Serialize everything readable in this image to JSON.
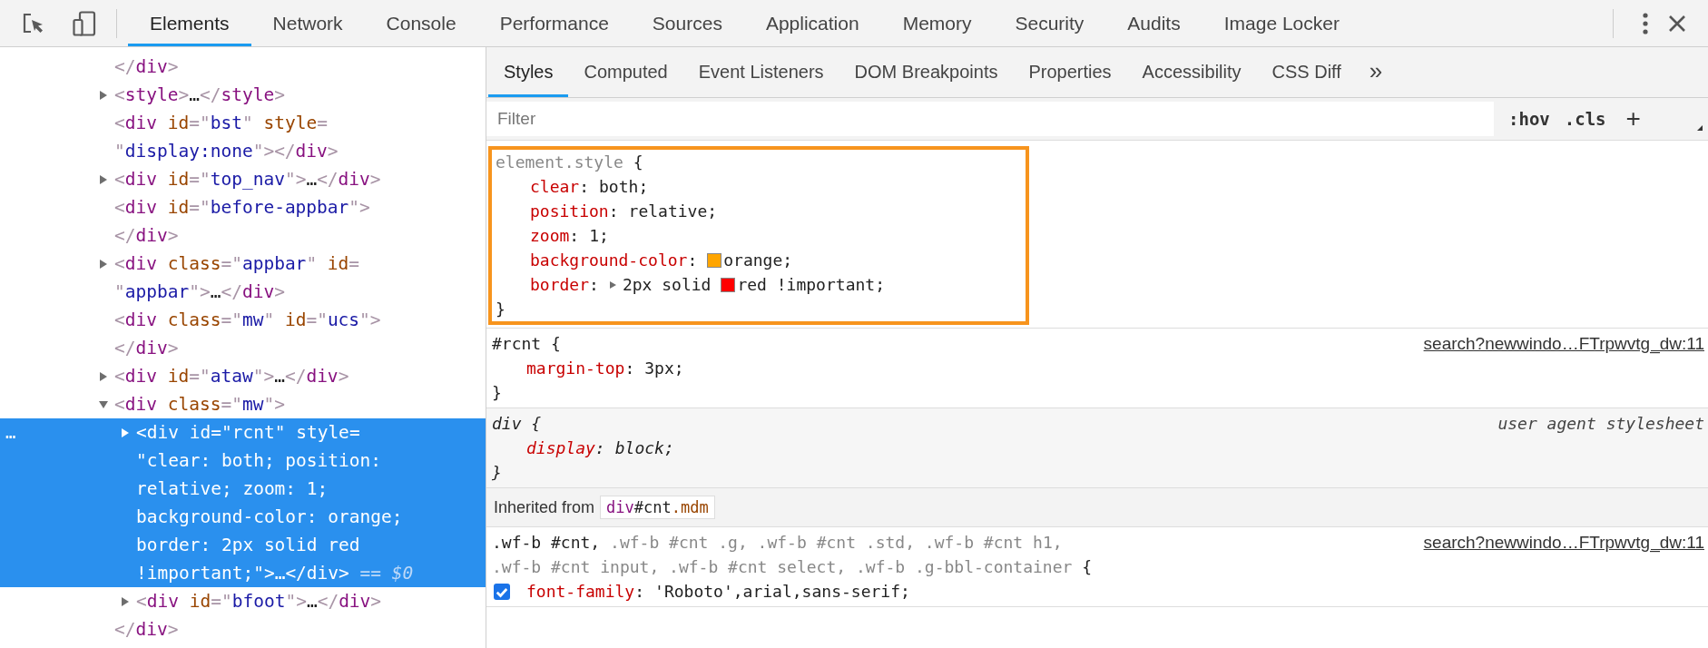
{
  "top_tabs": [
    {
      "label": "Elements",
      "selected": true
    },
    {
      "label": "Network",
      "selected": false
    },
    {
      "label": "Console",
      "selected": false
    },
    {
      "label": "Performance",
      "selected": false
    },
    {
      "label": "Sources",
      "selected": false
    },
    {
      "label": "Application",
      "selected": false
    },
    {
      "label": "Memory",
      "selected": false
    },
    {
      "label": "Security",
      "selected": false
    },
    {
      "label": "Audits",
      "selected": false
    },
    {
      "label": "Image Locker",
      "selected": false
    }
  ],
  "dom": [
    {
      "expandable": false,
      "expanded": false,
      "selected": false,
      "lines": [
        [
          {
            "kind": "punct",
            "text": "</"
          },
          {
            "kind": "tag",
            "text": "div"
          },
          {
            "kind": "punct",
            "text": ">"
          }
        ]
      ]
    },
    {
      "expandable": true,
      "expanded": false,
      "selected": false,
      "lines": [
        [
          {
            "kind": "punct",
            "text": "<"
          },
          {
            "kind": "tag",
            "text": "style"
          },
          {
            "kind": "punct",
            "text": ">"
          },
          {
            "kind": "text",
            "text": "…"
          },
          {
            "kind": "punct",
            "text": "</"
          },
          {
            "kind": "tag",
            "text": "style"
          },
          {
            "kind": "punct",
            "text": ">"
          }
        ]
      ]
    },
    {
      "expandable": false,
      "expanded": false,
      "selected": false,
      "lines": [
        [
          {
            "kind": "punct",
            "text": "<"
          },
          {
            "kind": "tag",
            "text": "div"
          },
          {
            "kind": "attr",
            "text": " id"
          },
          {
            "kind": "punct",
            "text": "=\""
          },
          {
            "kind": "value",
            "text": "bst"
          },
          {
            "kind": "punct",
            "text": "\""
          },
          {
            "kind": "attr",
            "text": " style"
          },
          {
            "kind": "punct",
            "text": "="
          }
        ],
        [
          {
            "kind": "punct",
            "text": "\""
          },
          {
            "kind": "value",
            "text": "display:none"
          },
          {
            "kind": "punct",
            "text": "\">"
          },
          {
            "kind": "punct",
            "text": "</"
          },
          {
            "kind": "tag",
            "text": "div"
          },
          {
            "kind": "punct",
            "text": ">"
          }
        ]
      ]
    },
    {
      "expandable": true,
      "expanded": false,
      "selected": false,
      "lines": [
        [
          {
            "kind": "punct",
            "text": "<"
          },
          {
            "kind": "tag",
            "text": "div"
          },
          {
            "kind": "attr",
            "text": " id"
          },
          {
            "kind": "punct",
            "text": "=\""
          },
          {
            "kind": "value",
            "text": "top_nav"
          },
          {
            "kind": "punct",
            "text": "\">"
          },
          {
            "kind": "text",
            "text": "…"
          },
          {
            "kind": "punct",
            "text": "</"
          },
          {
            "kind": "tag",
            "text": "div"
          },
          {
            "kind": "punct",
            "text": ">"
          }
        ]
      ]
    },
    {
      "expandable": false,
      "expanded": false,
      "selected": false,
      "lines": [
        [
          {
            "kind": "punct",
            "text": "<"
          },
          {
            "kind": "tag",
            "text": "div"
          },
          {
            "kind": "attr",
            "text": " id"
          },
          {
            "kind": "punct",
            "text": "=\""
          },
          {
            "kind": "value",
            "text": "before-appbar"
          },
          {
            "kind": "punct",
            "text": "\">"
          }
        ],
        [
          {
            "kind": "punct",
            "text": "</"
          },
          {
            "kind": "tag",
            "text": "div"
          },
          {
            "kind": "punct",
            "text": ">"
          }
        ]
      ]
    },
    {
      "expandable": true,
      "expanded": false,
      "selected": false,
      "lines": [
        [
          {
            "kind": "punct",
            "text": "<"
          },
          {
            "kind": "tag",
            "text": "div"
          },
          {
            "kind": "attr",
            "text": " class"
          },
          {
            "kind": "punct",
            "text": "=\""
          },
          {
            "kind": "value",
            "text": "appbar"
          },
          {
            "kind": "punct",
            "text": "\""
          },
          {
            "kind": "attr",
            "text": " id"
          },
          {
            "kind": "punct",
            "text": "="
          }
        ],
        [
          {
            "kind": "punct",
            "text": "\""
          },
          {
            "kind": "value",
            "text": "appbar"
          },
          {
            "kind": "punct",
            "text": "\">"
          },
          {
            "kind": "text",
            "text": "…"
          },
          {
            "kind": "punct",
            "text": "</"
          },
          {
            "kind": "tag",
            "text": "div"
          },
          {
            "kind": "punct",
            "text": ">"
          }
        ]
      ]
    },
    {
      "expandable": false,
      "expanded": false,
      "selected": false,
      "lines": [
        [
          {
            "kind": "punct",
            "text": "<"
          },
          {
            "kind": "tag",
            "text": "div"
          },
          {
            "kind": "attr",
            "text": " class"
          },
          {
            "kind": "punct",
            "text": "=\""
          },
          {
            "kind": "value",
            "text": "mw"
          },
          {
            "kind": "punct",
            "text": "\""
          },
          {
            "kind": "attr",
            "text": " id"
          },
          {
            "kind": "punct",
            "text": "=\""
          },
          {
            "kind": "value",
            "text": "ucs"
          },
          {
            "kind": "punct",
            "text": "\">"
          }
        ],
        [
          {
            "kind": "punct",
            "text": "</"
          },
          {
            "kind": "tag",
            "text": "div"
          },
          {
            "kind": "punct",
            "text": ">"
          }
        ]
      ]
    },
    {
      "expandable": true,
      "expanded": false,
      "selected": false,
      "lines": [
        [
          {
            "kind": "punct",
            "text": "<"
          },
          {
            "kind": "tag",
            "text": "div"
          },
          {
            "kind": "attr",
            "text": " id"
          },
          {
            "kind": "punct",
            "text": "=\""
          },
          {
            "kind": "value",
            "text": "ataw"
          },
          {
            "kind": "punct",
            "text": "\">"
          },
          {
            "kind": "text",
            "text": "…"
          },
          {
            "kind": "punct",
            "text": "</"
          },
          {
            "kind": "tag",
            "text": "div"
          },
          {
            "kind": "punct",
            "text": ">"
          }
        ]
      ]
    },
    {
      "expandable": true,
      "expanded": true,
      "selected": false,
      "lines": [
        [
          {
            "kind": "punct",
            "text": "<"
          },
          {
            "kind": "tag",
            "text": "div"
          },
          {
            "kind": "attr",
            "text": " class"
          },
          {
            "kind": "punct",
            "text": "=\""
          },
          {
            "kind": "value",
            "text": "mw"
          },
          {
            "kind": "punct",
            "text": "\">"
          }
        ]
      ],
      "children": [
        {
          "expandable": true,
          "expanded": false,
          "selected": true,
          "menu": "…",
          "lines": [
            [
              {
                "kind": "punct",
                "text": "<"
              },
              {
                "kind": "tag",
                "text": "div"
              },
              {
                "kind": "attr",
                "text": " id"
              },
              {
                "kind": "punct",
                "text": "=\""
              },
              {
                "kind": "value",
                "text": "rcnt"
              },
              {
                "kind": "punct",
                "text": "\""
              },
              {
                "kind": "attr",
                "text": " style"
              },
              {
                "kind": "punct",
                "text": "="
              }
            ],
            [
              {
                "kind": "punct",
                "text": "\""
              },
              {
                "kind": "value",
                "text": "clear: both; position:"
              }
            ],
            [
              {
                "kind": "value",
                "text": "relative; zoom: 1;"
              }
            ],
            [
              {
                "kind": "value",
                "text": "background-color: orange;"
              }
            ],
            [
              {
                "kind": "value",
                "text": "border: 2px solid red"
              }
            ],
            [
              {
                "kind": "value",
                "text": "!important;"
              },
              {
                "kind": "punct",
                "text": "\">"
              },
              {
                "kind": "text",
                "text": "…"
              },
              {
                "kind": "punct",
                "text": "</"
              },
              {
                "kind": "tag",
                "text": "div"
              },
              {
                "kind": "punct",
                "text": ">"
              },
              {
                "kind": "marker",
                "text": " == $0"
              }
            ]
          ]
        },
        {
          "expandable": true,
          "expanded": false,
          "selected": false,
          "lines": [
            [
              {
                "kind": "punct",
                "text": "<"
              },
              {
                "kind": "tag",
                "text": "div"
              },
              {
                "kind": "attr",
                "text": " id"
              },
              {
                "kind": "punct",
                "text": "=\""
              },
              {
                "kind": "value",
                "text": "bfoot"
              },
              {
                "kind": "punct",
                "text": "\">"
              },
              {
                "kind": "text",
                "text": "…"
              },
              {
                "kind": "punct",
                "text": "</"
              },
              {
                "kind": "tag",
                "text": "div"
              },
              {
                "kind": "punct",
                "text": ">"
              }
            ]
          ]
        }
      ],
      "closing": [
        [
          {
            "kind": "punct",
            "text": "</"
          },
          {
            "kind": "tag",
            "text": "div"
          },
          {
            "kind": "punct",
            "text": ">"
          }
        ]
      ]
    }
  ],
  "style_tabs": [
    {
      "label": "Styles",
      "selected": true
    },
    {
      "label": "Computed",
      "selected": false
    },
    {
      "label": "Event Listeners",
      "selected": false
    },
    {
      "label": "DOM Breakpoints",
      "selected": false
    },
    {
      "label": "Properties",
      "selected": false
    },
    {
      "label": "Accessibility",
      "selected": false
    },
    {
      "label": "CSS Diff",
      "selected": false
    }
  ],
  "style_tabs_more": "»",
  "filter": {
    "placeholder": "Filter"
  },
  "filter_buttons": [
    ":hov",
    ".cls",
    "+"
  ],
  "rules": [
    {
      "kind": "inline",
      "highlighted": true,
      "selector_lines": [
        [
          {
            "text": "element.style",
            "matched": false
          }
        ]
      ],
      "open": "{",
      "close": "}",
      "props": [
        {
          "name": "clear",
          "lead": ":",
          "expandable": false,
          "checked": false,
          "value": "both;"
        },
        {
          "name": "position",
          "lead": ":",
          "expandable": false,
          "checked": false,
          "value": "relative;"
        },
        {
          "name": "zoom",
          "lead": ":",
          "expandable": false,
          "checked": false,
          "value": "1;"
        },
        {
          "name": "background-color",
          "lead": ":",
          "expandable": false,
          "checked": false,
          "color": "#ffa500",
          "value": "orange;"
        },
        {
          "name": "border",
          "lead": ":",
          "expandable": true,
          "checked": false,
          "pre": "2px solid",
          "color": "#ff0000",
          "value": "red !important;"
        }
      ]
    },
    {
      "kind": "author",
      "highlighted": false,
      "source": "search?newwindo…FTrpwvtg_dw:11",
      "selector_lines": [
        [
          {
            "text": "#rcnt",
            "matched": true
          }
        ]
      ],
      "open": "{",
      "close": "}",
      "props": [
        {
          "name": "margin-top",
          "lead": ":",
          "expandable": false,
          "checked": false,
          "value": "3px;"
        }
      ]
    },
    {
      "kind": "useragent",
      "highlighted": false,
      "source": "user agent stylesheet",
      "selector_lines": [
        [
          {
            "text": "div",
            "matched": true
          }
        ]
      ],
      "open": "{",
      "close": "}",
      "props": [
        {
          "name": "display",
          "lead": ":",
          "expandable": false,
          "checked": false,
          "value": "block;"
        }
      ]
    }
  ],
  "inherited": {
    "label": "Inherited from",
    "element": [
      {
        "kind": "tag",
        "text": "div"
      },
      {
        "kind": "text",
        "text": "#cnt"
      },
      {
        "kind": "attr",
        "text": ".mdm"
      }
    ]
  },
  "inherited_rules": [
    {
      "kind": "author",
      "highlighted": false,
      "source": "search?newwindo…FTrpwvtg_dw:11",
      "selector_lines": [
        [
          {
            "text": ".wf-b #cnt,",
            "matched": true
          },
          {
            "text": " .wf-b #cnt .g, .wf-b #cnt .std, .wf-b #cnt h1,",
            "matched": false
          }
        ],
        [
          {
            "text": ".wf-b #cnt input, .wf-b #cnt select, .wf-b .g-bbl-container",
            "matched": false
          }
        ]
      ],
      "open": "{",
      "props": [
        {
          "name": "font-family",
          "lead": ":",
          "expandable": false,
          "checked": true,
          "value": "'Roboto',arial,sans-serif;"
        }
      ]
    }
  ]
}
